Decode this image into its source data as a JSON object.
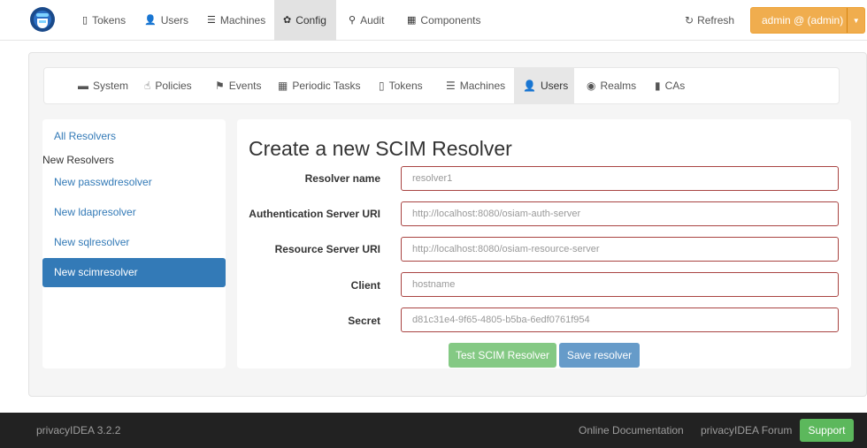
{
  "topnav": {
    "items": [
      {
        "icon": "phone-icon",
        "glyph": "▯",
        "label": "Tokens"
      },
      {
        "icon": "user-icon",
        "glyph": "👤",
        "label": "Users"
      },
      {
        "icon": "server-icon",
        "glyph": "☰",
        "label": "Machines"
      },
      {
        "icon": "gear-icon",
        "glyph": "✿",
        "label": "Config"
      },
      {
        "icon": "search-icon",
        "glyph": "⚲",
        "label": "Audit"
      },
      {
        "icon": "calendar-icon",
        "glyph": "▦",
        "label": "Components"
      }
    ],
    "refresh": {
      "icon": "refresh-icon",
      "glyph": "↻",
      "label": "Refresh"
    },
    "user_button": "admin @ (admin)"
  },
  "subnav": {
    "items": [
      {
        "icon": "briefcase-icon",
        "glyph": "▬",
        "label": "System"
      },
      {
        "icon": "hand-icon",
        "glyph": "☝",
        "label": "Policies"
      },
      {
        "icon": "flag-icon",
        "glyph": "⚑",
        "label": "Events"
      },
      {
        "icon": "calendar-icon",
        "glyph": "▦",
        "label": "Periodic Tasks"
      },
      {
        "icon": "phone-icon",
        "glyph": "▯",
        "label": "Tokens"
      },
      {
        "icon": "server-icon",
        "glyph": "☰",
        "label": "Machines"
      },
      {
        "icon": "user-icon",
        "glyph": "👤",
        "label": "Users"
      },
      {
        "icon": "globe-icon",
        "glyph": "◉",
        "label": "Realms"
      },
      {
        "icon": "bookmark-icon",
        "glyph": "▮",
        "label": "CAs"
      }
    ]
  },
  "sidebar": {
    "all_resolvers": "All Resolvers",
    "new_resolvers_header": "New Resolvers",
    "entries": [
      "New passwdresolver",
      "New ldapresolver",
      "New sqlresolver",
      "New scimresolver"
    ]
  },
  "form": {
    "title": "Create a new SCIM Resolver",
    "fields": [
      {
        "label": "Resolver name",
        "placeholder": "resolver1"
      },
      {
        "label": "Authentication Server URI",
        "placeholder": "http://localhost:8080/osiam-auth-server"
      },
      {
        "label": "Resource Server URI",
        "placeholder": "http://localhost:8080/osiam-resource-server"
      },
      {
        "label": "Client",
        "placeholder": "hostname"
      },
      {
        "label": "Secret",
        "placeholder": "d81c31e4-9f65-4805-b5ba-6edf0761f954"
      }
    ],
    "test_button": "Test SCIM Resolver",
    "save_button": "Save resolver"
  },
  "footer": {
    "version": "privacyIDEA 3.2.2",
    "doc_link": "Online Documentation",
    "forum_link": "privacyIDEA Forum",
    "support_button": "Support"
  },
  "colors": {
    "accent": "#337ab7",
    "warning": "#f0ad4e",
    "success": "#5cb85c",
    "error_border": "#a94442",
    "footer_bg": "#222222"
  }
}
